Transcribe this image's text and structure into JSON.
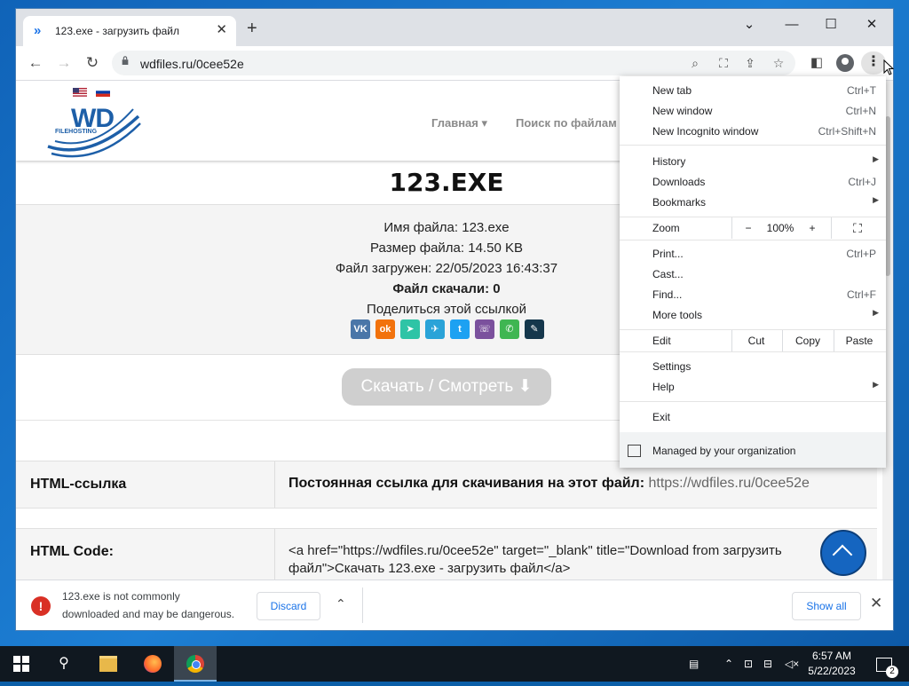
{
  "browser": {
    "tab_title": "123.exe - загрузить файл",
    "url": "wdfiles.ru/0cee52e"
  },
  "site": {
    "logo_text": "WD",
    "logo_sub": "FILEHOSTING",
    "nav": [
      "Главная",
      "Поиск по файлам"
    ],
    "file_title": "123.EXE",
    "info": {
      "name_label": "Имя файла:",
      "name_value": "123.exe",
      "size_label": "Размер файла:",
      "size_value": "14.50 KB",
      "uploaded_label": "Файл загружен:",
      "uploaded_value": "22/05/2023 16:43:37",
      "downloads_label": "Файл скачали:",
      "downloads_value": "0",
      "share_label": "Поделиться этой ссылкой"
    },
    "share_icons": [
      {
        "name": "vk",
        "glyph": "VK",
        "color": "#4a76a8"
      },
      {
        "name": "ok",
        "glyph": "ok",
        "color": "#f2720c"
      },
      {
        "name": "sms",
        "glyph": "➤",
        "color": "#2ec4a6"
      },
      {
        "name": "telegram",
        "glyph": "✈",
        "color": "#2aa3d8"
      },
      {
        "name": "twitter",
        "glyph": "t",
        "color": "#1da1f2"
      },
      {
        "name": "viber",
        "glyph": "☏",
        "color": "#7b519d"
      },
      {
        "name": "whatsapp",
        "glyph": "✆",
        "color": "#3fb652"
      },
      {
        "name": "livejournal",
        "glyph": "✎",
        "color": "#15374c"
      }
    ],
    "download_button": "Скачать / Смотреть ⬇",
    "rows": [
      {
        "label": "HTML-ссылка",
        "text_bold": "Постоянная ссылка для скачивания на этот файл:",
        "text": " https://wdfiles.ru/0cee52e"
      },
      {
        "label": "HTML Code:",
        "text_line1": "<a href=\"https://wdfiles.ru/0cee52e\" target=\"_blank\" title=\"Download from загрузить",
        "text_line2": "файл\">Скачать 123.exe - загрузить файл</a>"
      }
    ]
  },
  "download_bar": {
    "line1": "123.exe is not commonly",
    "line2": "downloaded and may be dangerous.",
    "discard": "Discard",
    "show_all": "Show all"
  },
  "menu": {
    "new_tab": {
      "label": "New tab",
      "shortcut": "Ctrl+T"
    },
    "new_window": {
      "label": "New window",
      "shortcut": "Ctrl+N"
    },
    "incognito": {
      "label": "New Incognito window",
      "shortcut": "Ctrl+Shift+N"
    },
    "history": {
      "label": "History"
    },
    "downloads": {
      "label": "Downloads",
      "shortcut": "Ctrl+J"
    },
    "bookmarks": {
      "label": "Bookmarks"
    },
    "zoom": {
      "label": "Zoom",
      "minus": "−",
      "value": "100%",
      "plus": "+"
    },
    "print": {
      "label": "Print...",
      "shortcut": "Ctrl+P"
    },
    "cast": {
      "label": "Cast..."
    },
    "find": {
      "label": "Find...",
      "shortcut": "Ctrl+F"
    },
    "more_tools": {
      "label": "More tools"
    },
    "edit": {
      "label": "Edit",
      "cut": "Cut",
      "copy": "Copy",
      "paste": "Paste"
    },
    "settings": {
      "label": "Settings"
    },
    "help": {
      "label": "Help"
    },
    "exit": {
      "label": "Exit"
    },
    "managed": "Managed by your organization"
  },
  "taskbar": {
    "time": "6:57 AM",
    "date": "5/22/2023",
    "notifications": "2"
  }
}
